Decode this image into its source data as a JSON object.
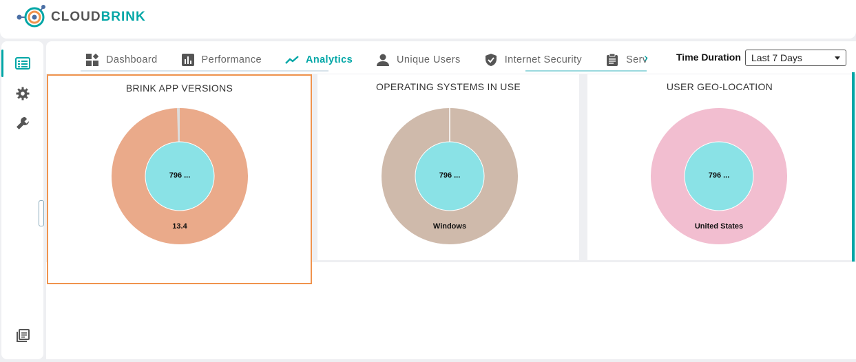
{
  "brand": {
    "name_part1": "CLOUD",
    "name_part2": "BRINK"
  },
  "sidebar": {
    "items": [
      {
        "name": "list-icon",
        "active": true
      },
      {
        "name": "gear-icon",
        "active": false
      },
      {
        "name": "wrench-icon",
        "active": false
      },
      {
        "name": "library-icon",
        "active": false
      }
    ]
  },
  "tabs": [
    {
      "label": "Dashboard",
      "icon": "dashboard-icon",
      "active": false
    },
    {
      "label": "Performance",
      "icon": "bar-chart-icon",
      "active": false
    },
    {
      "label": "Analytics",
      "icon": "trend-line-icon",
      "active": true
    },
    {
      "label": "Unique Users",
      "icon": "user-icon",
      "active": false
    },
    {
      "label": "Internet Security",
      "icon": "shield-icon",
      "active": false
    },
    {
      "label": "Serv",
      "icon": "clipboard-icon",
      "active": false
    }
  ],
  "time_duration": {
    "label": "Time Duration",
    "value": "Last 7 Days"
  },
  "cards": [
    {
      "title": "BRINK APP VERSIONS",
      "center_label": "796 ...",
      "slice_label": "13.4",
      "outer_color": "#eaaa8a",
      "inner_color": "#8ae2e6"
    },
    {
      "title": "OPERATING SYSTEMS IN USE",
      "center_label": "796 ...",
      "slice_label": "Windows",
      "outer_color": "#cfbaab",
      "inner_color": "#8ae2e6"
    },
    {
      "title": "USER GEO-LOCATION",
      "center_label": "796 ...",
      "slice_label": "United States",
      "outer_color": "#f2bed0",
      "inner_color": "#8ae2e6"
    }
  ],
  "colors": {
    "accent": "#00a6a6",
    "selected_border": "#f0934d"
  }
}
